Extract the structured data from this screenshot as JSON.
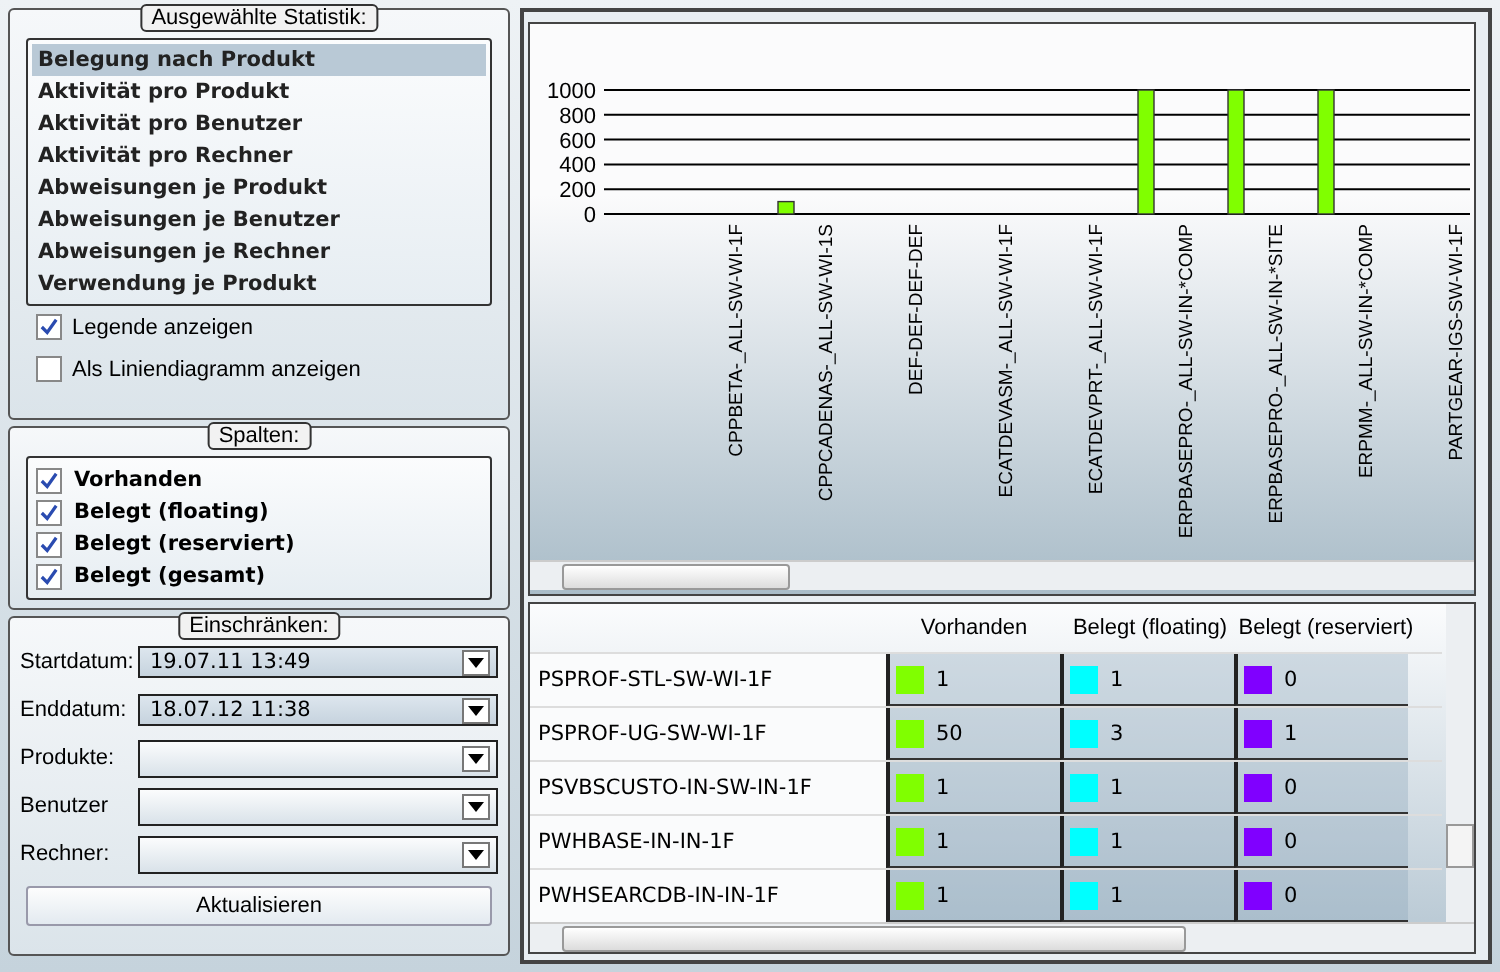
{
  "statistics": {
    "title": "Ausgewählte Statistik:",
    "items": [
      {
        "label": "Belegung nach Produkt",
        "selected": true
      },
      {
        "label": "Aktivität pro Produkt",
        "selected": false
      },
      {
        "label": "Aktivität pro Benutzer",
        "selected": false
      },
      {
        "label": "Aktivität pro Rechner",
        "selected": false
      },
      {
        "label": "Abweisungen je Produkt",
        "selected": false
      },
      {
        "label": "Abweisungen je Benutzer",
        "selected": false
      },
      {
        "label": "Abweisungen je Rechner",
        "selected": false
      },
      {
        "label": "Verwendung je Produkt",
        "selected": false
      }
    ],
    "options": [
      {
        "label": "Legende anzeigen",
        "checked": true
      },
      {
        "label": "Als Liniendiagramm anzeigen",
        "checked": false
      }
    ]
  },
  "columns_group": {
    "title": "Spalten:",
    "items": [
      {
        "label": "Vorhanden",
        "checked": true
      },
      {
        "label": "Belegt (floating)",
        "checked": true
      },
      {
        "label": "Belegt (reserviert)",
        "checked": true
      },
      {
        "label": "Belegt (gesamt)",
        "checked": true
      }
    ]
  },
  "filter": {
    "title": "Einschränken:",
    "fields": [
      {
        "label": "Startdatum:",
        "value": "19.07.11 13:49"
      },
      {
        "label": "Enddatum:",
        "value": "18.07.12 11:38"
      },
      {
        "label": "Produkte:"
      },
      {
        "label": "Benutzer"
      },
      {
        "label": "Rechner:"
      }
    ],
    "button": "Aktualisieren"
  },
  "chart": {
    "chart_data": {
      "type": "bar",
      "categories": [
        "CPPBETA-_ALL-SW-WI-1F",
        "CPPCADENAS-_ALL-SW-WI-1S",
        "DEF-DEF-DEF-DEF",
        "ECATDEVASM-_ALL-SW-WI-1F",
        "ECATDEVPRT-_ALL-SW-WI-1F",
        "ERPBASEPRO-_ALL-SW-IN-*COMP",
        "ERPBASEPRO-_ALL-SW-IN-*SITE",
        "ERPMM-_ALL-SW-IN-*COMP",
        "PARTGEAR-IGS-SW-WI-1F"
      ],
      "series": [
        {
          "color": "#80ff00",
          "values": [
            0,
            100,
            0,
            0,
            0,
            1000,
            1000,
            1000,
            0
          ]
        }
      ],
      "grid": true,
      "ylim": [
        0,
        1000
      ],
      "yticks": [
        {
          "value": 0,
          "label": "0"
        },
        {
          "value": 200,
          "label": "200"
        },
        {
          "value": 400,
          "label": "400"
        },
        {
          "value": 600,
          "label": "600"
        },
        {
          "value": 800,
          "label": "800"
        },
        {
          "value": 1000,
          "label": "1000"
        }
      ]
    }
  },
  "table": {
    "columns": [
      {
        "label": "Vorhanden",
        "color": "#80ff00"
      },
      {
        "label": "Belegt (floating)",
        "color": "#00ffff"
      },
      {
        "label": "Belegt (reserviert)",
        "color": "#8000ff"
      }
    ],
    "rows": [
      {
        "name": "PSPROF-STL-SW-WI-1F",
        "values": [
          "1",
          "1",
          "0"
        ]
      },
      {
        "name": "PSPROF-UG-SW-WI-1F",
        "values": [
          "50",
          "3",
          "1"
        ]
      },
      {
        "name": "PSVBSCUSTO-IN-SW-IN-1F",
        "values": [
          "1",
          "1",
          "0"
        ]
      },
      {
        "name": "PWHBASE-IN-IN-1F",
        "values": [
          "1",
          "1",
          "0"
        ]
      },
      {
        "name": "PWHSEARCDB-IN-IN-1F",
        "values": [
          "1",
          "1",
          "0"
        ]
      }
    ]
  }
}
